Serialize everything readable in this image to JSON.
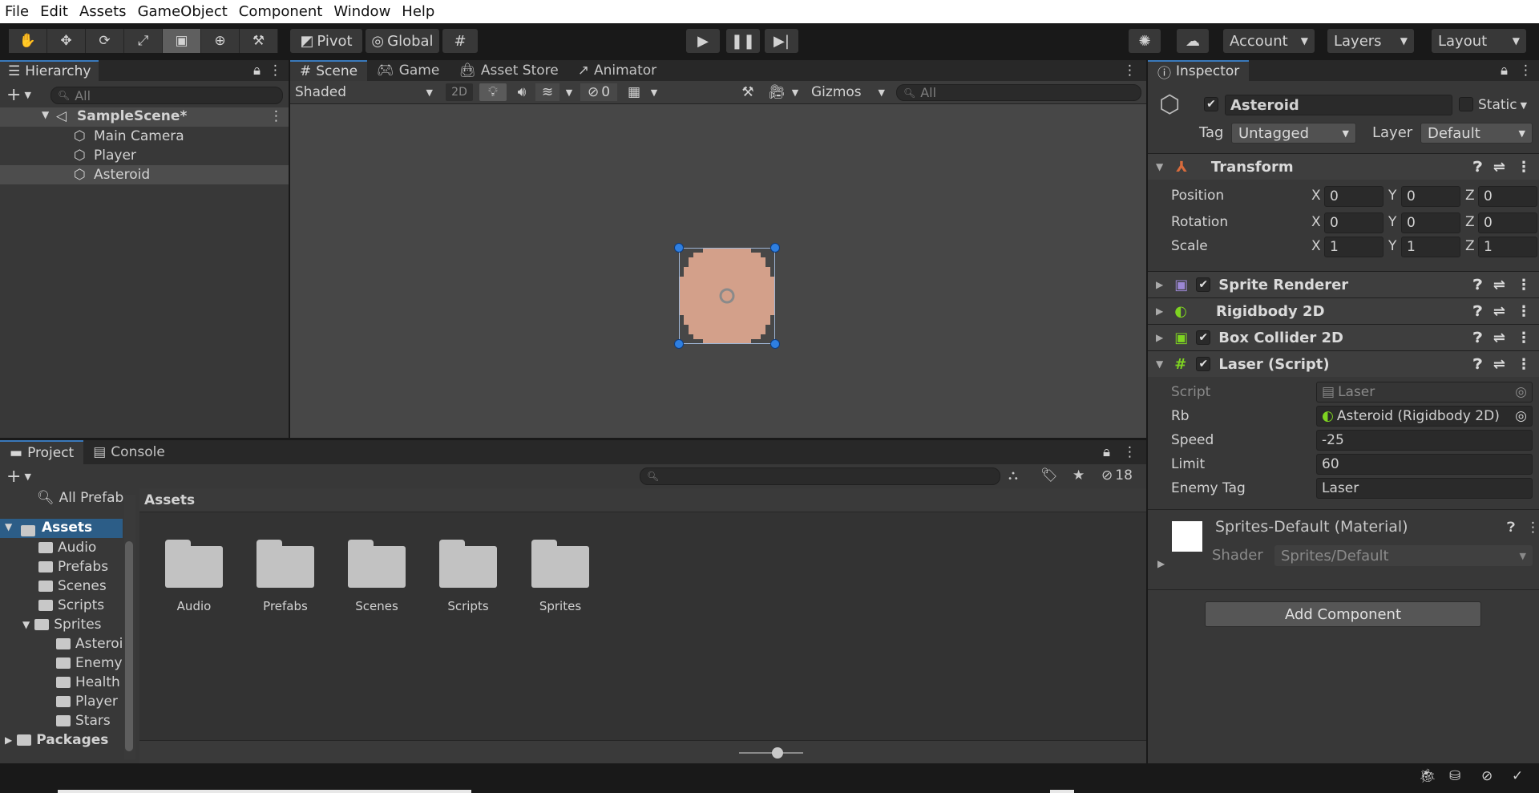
{
  "menu": [
    "File",
    "Edit",
    "Assets",
    "GameObject",
    "Component",
    "Window",
    "Help"
  ],
  "toolbar": {
    "pivot": "Pivot",
    "global": "Global",
    "account": "Account",
    "layers": "Layers",
    "layout": "Layout"
  },
  "hierarchy": {
    "tab": "Hierarchy",
    "search_placeholder": "All",
    "scene": "SampleScene*",
    "items": [
      "Main Camera",
      "Player",
      "Asteroid"
    ]
  },
  "scene": {
    "tabs": [
      "Scene",
      "Game",
      "Asset Store",
      "Animator"
    ],
    "shading": "Shaded",
    "mode2d": "2D",
    "hidden_count": "0",
    "gizmos": "Gizmos",
    "search_placeholder": "All"
  },
  "inspector": {
    "tab": "Inspector",
    "object_name": "Asteroid",
    "static_label": "Static",
    "tag_label": "Tag",
    "tag_value": "Untagged",
    "layer_label": "Layer",
    "layer_value": "Default",
    "transform": {
      "title": "Transform",
      "position_label": "Position",
      "rotation_label": "Rotation",
      "scale_label": "Scale",
      "position": [
        "0",
        "0",
        "0"
      ],
      "rotation": [
        "0",
        "0",
        "0"
      ],
      "scale": [
        "1",
        "1",
        "1"
      ],
      "axes": [
        "X",
        "Y",
        "Z"
      ]
    },
    "components": [
      "Sprite Renderer",
      "Rigidbody 2D",
      "Box Collider 2D",
      "Laser (Script)"
    ],
    "laser": {
      "script_label": "Script",
      "script_value": "Laser",
      "rb_label": "Rb",
      "rb_value": "Asteroid (Rigidbody 2D)",
      "speed_label": "Speed",
      "speed_value": "-25",
      "limit_label": "Limit",
      "limit_value": "60",
      "enemytag_label": "Enemy Tag",
      "enemytag_value": "Laser"
    },
    "material": {
      "name": "Sprites-Default (Material)",
      "shader_label": "Shader",
      "shader_value": "Sprites/Default"
    },
    "add_component": "Add Component"
  },
  "project": {
    "tabs": [
      "Project",
      "Console"
    ],
    "hidden_count": "18",
    "all_prefabs": "All Prefab",
    "breadcrumb": "Assets",
    "tree": {
      "assets": "Assets",
      "children": [
        "Audio",
        "Prefabs",
        "Scenes",
        "Scripts"
      ],
      "sprites": "Sprites",
      "sprite_children": [
        "Asteroi",
        "Enemy",
        "Health",
        "Player",
        "Stars"
      ],
      "packages": "Packages"
    },
    "folders": [
      "Audio",
      "Prefabs",
      "Scenes",
      "Scripts",
      "Sprites"
    ],
    "zoom_level": 0.6
  },
  "colors": {
    "accent": "#3a79bb",
    "selection": "#2c5d87",
    "asteroid": "#d3a08a"
  }
}
